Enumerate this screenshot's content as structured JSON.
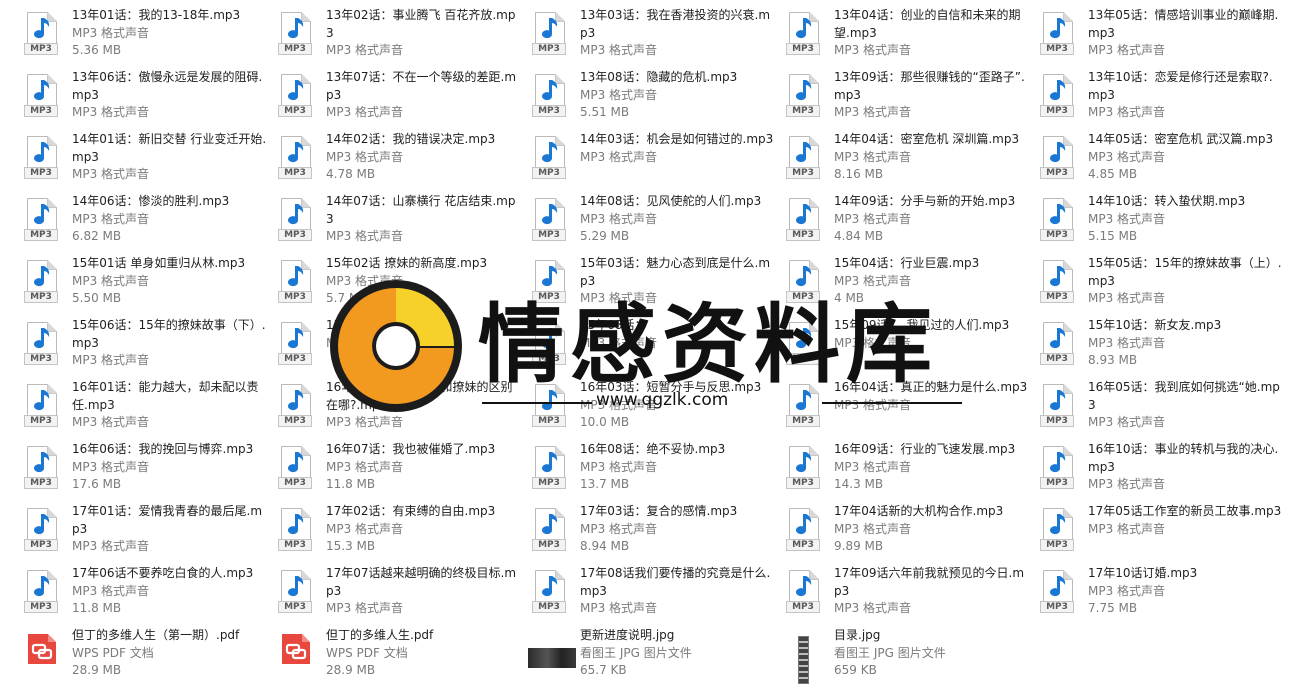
{
  "files": [
    {
      "name": "13年01话：我的13-18年.mp3",
      "type": "MP3 格式声音",
      "size": "5.36 MB",
      "icon": "mp3"
    },
    {
      "name": "13年02话：事业腾飞 百花齐放.mp3",
      "type": "MP3 格式声音",
      "size": "",
      "icon": "mp3"
    },
    {
      "name": "13年03话：我在香港投资的兴衰.mp3",
      "type": "MP3 格式声音",
      "size": "",
      "icon": "mp3"
    },
    {
      "name": "13年04话：创业的自信和未来的期望.mp3",
      "type": "MP3 格式声音",
      "size": "",
      "icon": "mp3"
    },
    {
      "name": "13年05话：情感培训事业的巅峰期.mp3",
      "type": "MP3 格式声音",
      "size": "",
      "icon": "mp3"
    },
    {
      "name": "13年06话：傲慢永远是发展的阻碍.mp3",
      "type": "MP3 格式声音",
      "size": "",
      "icon": "mp3"
    },
    {
      "name": "13年07话：不在一个等级的差距.mp3",
      "type": "MP3 格式声音",
      "size": "",
      "icon": "mp3"
    },
    {
      "name": "13年08话：隐藏的危机.mp3",
      "type": "MP3 格式声音",
      "size": "5.51 MB",
      "icon": "mp3"
    },
    {
      "name": "13年09话：那些很赚钱的“歪路子”.mp3",
      "type": "MP3 格式声音",
      "size": "",
      "icon": "mp3"
    },
    {
      "name": "13年10话：恋爱是修行还是索取?.mp3",
      "type": "MP3 格式声音",
      "size": "",
      "icon": "mp3"
    },
    {
      "name": "14年01话：新旧交替 行业变迁开始.mp3",
      "type": "MP3 格式声音",
      "size": "",
      "icon": "mp3"
    },
    {
      "name": "14年02话：我的错误决定.mp3",
      "type": "MP3 格式声音",
      "size": "4.78 MB",
      "icon": "mp3"
    },
    {
      "name": "14年03话：机会是如何错过的.mp3",
      "type": "MP3 格式声音",
      "size": "",
      "icon": "mp3"
    },
    {
      "name": "14年04话：密室危机 深圳篇.mp3",
      "type": "MP3 格式声音",
      "size": "8.16 MB",
      "icon": "mp3"
    },
    {
      "name": "14年05话：密室危机 武汉篇.mp3",
      "type": "MP3 格式声音",
      "size": "4.85 MB",
      "icon": "mp3"
    },
    {
      "name": "14年06话：惨淡的胜利.mp3",
      "type": "MP3 格式声音",
      "size": "6.82 MB",
      "icon": "mp3"
    },
    {
      "name": "14年07话：山寨横行 花店结束.mp3",
      "type": "MP3 格式声音",
      "size": "",
      "icon": "mp3"
    },
    {
      "name": "14年08话：见风使舵的人们.mp3",
      "type": "MP3 格式声音",
      "size": "5.29 MB",
      "icon": "mp3"
    },
    {
      "name": "14年09话：分手与新的开始.mp3",
      "type": "MP3 格式声音",
      "size": "4.84 MB",
      "icon": "mp3"
    },
    {
      "name": "14年10话：转入蛰伏期.mp3",
      "type": "MP3 格式声音",
      "size": "5.15 MB",
      "icon": "mp3"
    },
    {
      "name": "15年01话 单身如重归从林.mp3",
      "type": "MP3 格式声音",
      "size": "5.50 MB",
      "icon": "mp3"
    },
    {
      "name": "15年02话 撩妹的新高度.mp3",
      "type": "MP3 格式声音",
      "size": "5.7 MB",
      "icon": "mp3"
    },
    {
      "name": "15年03话：魅力心态到底是什么.mp3",
      "type": "MP3 格式声音",
      "size": "",
      "icon": "mp3"
    },
    {
      "name": "15年04话：行业巨震.mp3",
      "type": "MP3 格式声音",
      "size": "4 MB",
      "icon": "mp3"
    },
    {
      "name": "15年05话：15年的撩妹故事（上）.mp3",
      "type": "MP3 格式声音",
      "size": "",
      "icon": "mp3"
    },
    {
      "name": "15年06话：15年的撩妹故事（下）.mp3",
      "type": "MP3 格式声音",
      "size": "",
      "icon": "mp3"
    },
    {
      "name": "15年07话：",
      "type": "MP3 格式声音",
      "size": "",
      "icon": "mp3"
    },
    {
      "name": "15年08话：",
      "type": "MP3 格式声音",
      "size": "",
      "icon": "mp3"
    },
    {
      "name": "15年09话：，我见过的人们.mp3",
      "type": "MP3 格式声音",
      "size": "",
      "icon": "mp3"
    },
    {
      "name": "15年10话：新女友.mp3",
      "type": "MP3 格式声音",
      "size": "8.93 MB",
      "icon": "mp3"
    },
    {
      "name": "16年01话：能力越大，却未配以责任.mp3",
      "type": "MP3 格式声音",
      "size": "",
      "icon": "mp3"
    },
    {
      "name": "16年02话：长期关系和撩妹的区别在哪?.mp3",
      "type": "MP3 格式声音",
      "size": "",
      "icon": "mp3"
    },
    {
      "name": "16年03话：短暂分手与反思.mp3",
      "type": "MP3 格式声音",
      "size": "10.0 MB",
      "icon": "mp3"
    },
    {
      "name": "16年04话：真正的魅力是什么.mp3",
      "type": "MP3 格式声音",
      "size": "",
      "icon": "mp3"
    },
    {
      "name": "16年05话：我到底如何挑选“她.mp3",
      "type": "MP3 格式声音",
      "size": "",
      "icon": "mp3"
    },
    {
      "name": "16年06话：我的挽回与博弈.mp3",
      "type": "MP3 格式声音",
      "size": "17.6 MB",
      "icon": "mp3"
    },
    {
      "name": "16年07话：我也被催婚了.mp3",
      "type": "MP3 格式声音",
      "size": "11.8 MB",
      "icon": "mp3"
    },
    {
      "name": "16年08话：绝不妥协.mp3",
      "type": "MP3 格式声音",
      "size": "13.7 MB",
      "icon": "mp3"
    },
    {
      "name": "16年09话：行业的飞速发展.mp3",
      "type": "MP3 格式声音",
      "size": "14.3 MB",
      "icon": "mp3"
    },
    {
      "name": "16年10话：事业的转机与我的决心.mp3",
      "type": "MP3 格式声音",
      "size": "",
      "icon": "mp3"
    },
    {
      "name": "17年01话：爱情我青春的最后尾.mp3",
      "type": "MP3 格式声音",
      "size": "",
      "icon": "mp3"
    },
    {
      "name": "17年02话：有束缚的自由.mp3",
      "type": "MP3 格式声音",
      "size": "15.3 MB",
      "icon": "mp3"
    },
    {
      "name": "17年03话：复合的感情.mp3",
      "type": "MP3 格式声音",
      "size": "8.94 MB",
      "icon": "mp3"
    },
    {
      "name": "17年04话新的大机构合作.mp3",
      "type": "MP3 格式声音",
      "size": "9.89 MB",
      "icon": "mp3"
    },
    {
      "name": "17年05话工作室的新员工故事.mp3",
      "type": "MP3 格式声音",
      "size": "",
      "icon": "mp3"
    },
    {
      "name": "17年06话不要养吃白食的人.mp3",
      "type": "MP3 格式声音",
      "size": "11.8 MB",
      "icon": "mp3"
    },
    {
      "name": "17年07话越来越明确的终极目标.mp3",
      "type": "MP3 格式声音",
      "size": "",
      "icon": "mp3"
    },
    {
      "name": "17年08话我们要传播的究竟是什么.mp3",
      "type": "MP3 格式声音",
      "size": "",
      "icon": "mp3"
    },
    {
      "name": "17年09话六年前我就预见的今日.mp3",
      "type": "MP3 格式声音",
      "size": "",
      "icon": "mp3"
    },
    {
      "name": "17年10话订婚.mp3",
      "type": "MP3 格式声音",
      "size": "7.75 MB",
      "icon": "mp3"
    },
    {
      "name": "但丁的多维人生（第一期）.pdf",
      "type": "WPS PDF 文档",
      "size": "28.9 MB",
      "icon": "pdf"
    },
    {
      "name": "但丁的多维人生.pdf",
      "type": "WPS PDF 文档",
      "size": "28.9 MB",
      "icon": "pdf"
    },
    {
      "name": "更新进度说明.jpg",
      "type": "看图王 JPG 图片文件",
      "size": "65.7 KB",
      "icon": "jpg-dark"
    },
    {
      "name": "目录.jpg",
      "type": "看图王 JPG 图片文件",
      "size": "659 KB",
      "icon": "jpg-strip"
    }
  ],
  "mp3_label": "MP3",
  "watermark": {
    "text": "情感资料库",
    "url": "www.qgzlk.com",
    "colors": {
      "orange": "#f29a1f",
      "yellow": "#f6d12a",
      "dark": "#1c1c1c"
    }
  },
  "colors": {
    "pdf_red": "#e8473e",
    "mp3_note": "#1a78d4"
  }
}
